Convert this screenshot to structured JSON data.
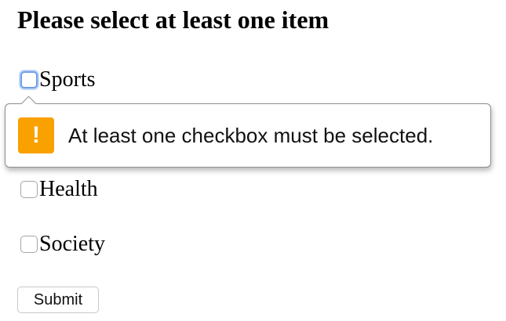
{
  "page": {
    "title": "Please select at least one item"
  },
  "options": [
    {
      "label": "Sports",
      "checked": false,
      "focused": true
    },
    {
      "label": "Health",
      "checked": false,
      "focused": false
    },
    {
      "label": "Society",
      "checked": false,
      "focused": false
    }
  ],
  "form": {
    "submit_label": "Submit"
  },
  "validation": {
    "message": "At least one checkbox must be selected.",
    "icon": "warning-icon",
    "icon_glyph": "!",
    "icon_color": "#f8a100"
  },
  "colors": {
    "focus_ring": "#6f9ee8"
  }
}
